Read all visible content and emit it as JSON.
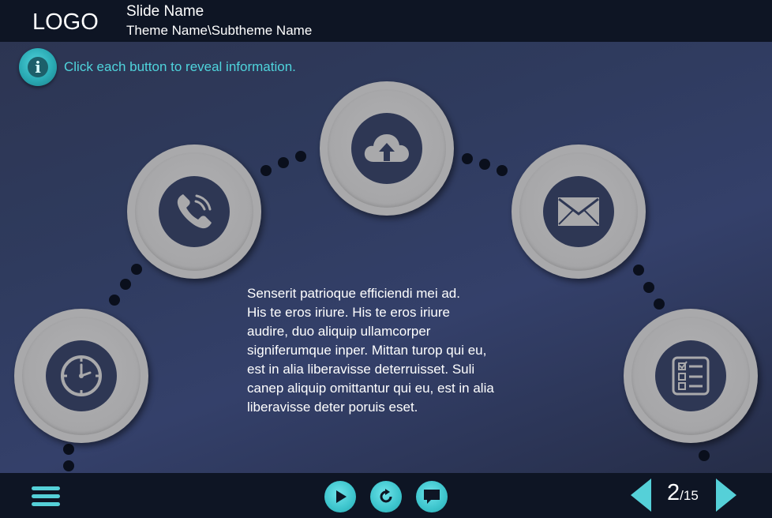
{
  "header": {
    "logo": "LOGO",
    "slide_name": "Slide Name",
    "theme_name": "Theme Name\\Subtheme Name"
  },
  "instruction": {
    "icon": "info-icon",
    "icon_glyph": "i",
    "text": "Click each button to reveal information."
  },
  "buttons": [
    {
      "name": "clock-button",
      "icon": "clock-icon"
    },
    {
      "name": "phone-button",
      "icon": "phone-icon"
    },
    {
      "name": "cloud-upload-button",
      "icon": "cloud-upload-icon"
    },
    {
      "name": "email-button",
      "icon": "envelope-icon"
    },
    {
      "name": "checklist-button",
      "icon": "checklist-icon"
    }
  ],
  "content": {
    "text_lines": [
      "Senserit patrioque efficiendi mei ad.",
      "His te eros iriure. His te eros iriure",
      "audire, duo aliquip ullamcorper",
      "signiferumque inper. Mittan turop qui eu,",
      "est in alia liberavisse deterruisset. Suli",
      "canep aliquip omittantur qui eu, est in alia",
      "liberavisse deter poruis eset."
    ]
  },
  "footer": {
    "controls": [
      "menu-icon",
      "play-icon",
      "replay-icon",
      "comment-icon"
    ],
    "page_current": "2",
    "page_total": "/15"
  },
  "colors": {
    "accent": "#4fd4dc",
    "bar_background": "#0e1524",
    "button_gray": "#a9a9ab",
    "icon_core": "#2e3754"
  }
}
